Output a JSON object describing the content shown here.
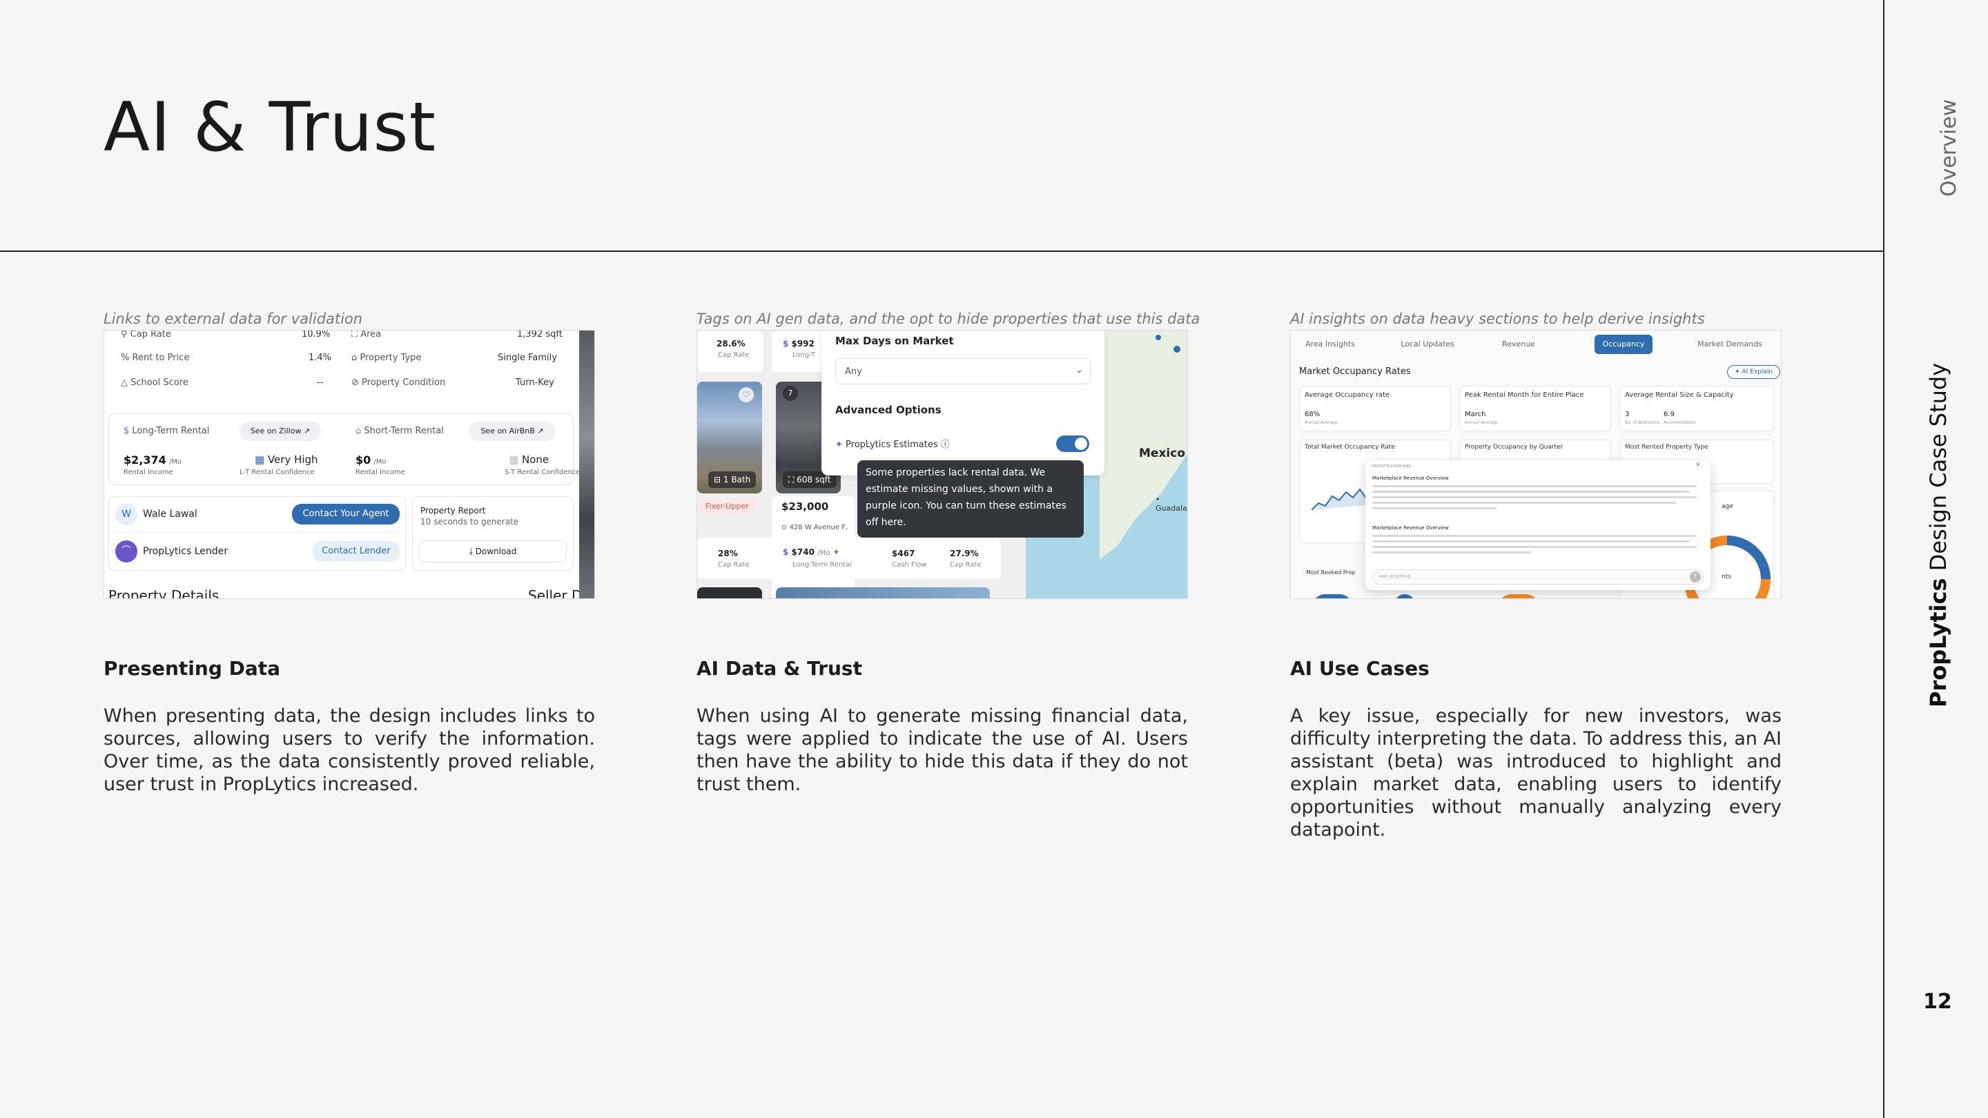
{
  "page": {
    "title": "AI & Trust",
    "side_overview": "Overview",
    "side_brand": "PropLytics",
    "side_study": "Design Case Study",
    "page_number": "12"
  },
  "columns": [
    {
      "caption": "Links to external data for validation",
      "heading": "Presenting Data",
      "body": "When presenting data, the design includes links to sources, allowing users to verify the information. Over time, as the data consistently proved reliable, user trust in PropLytics increased."
    },
    {
      "caption": "Tags on AI gen data, and the opt to hide properties that use this data",
      "heading": "AI Data & Trust",
      "body": "When using AI to generate missing financial data, tags were applied to indicate the use of AI. Users then have the ability to hide this data if they do not trust them."
    },
    {
      "caption": "AI insights on data heavy sections to help derive insights",
      "heading": "AI Use Cases",
      "body": "A key issue, especially for new investors, was difficulty interpreting the data. To address this, an AI assistant (beta) was introduced to highlight and explain market data, enabling users to identify opportunities without manually analyzing every datapoint."
    }
  ],
  "shot1": {
    "rows": [
      {
        "label": "Cap Rate",
        "value": "10.9%",
        "label2": "Area",
        "value2": "1,392 sqft"
      },
      {
        "label": "Rent to Price",
        "value": "1.4%",
        "label2": "Property Type",
        "value2": "Single Family"
      },
      {
        "label": "School Score",
        "value": "--",
        "label2": "Property Condition",
        "value2": "Turn-Key"
      }
    ],
    "long_term": {
      "label": "Long-Term Rental",
      "link": "See on Zillow",
      "amount": "$2,374",
      "unit": "/Mo",
      "sub": "Rental Income",
      "confidence": "Very High",
      "confidence_sub": "L-T Rental Confidence"
    },
    "short_term": {
      "label": "Short-Term Rental",
      "link": "See on AirBnB",
      "amount": "$0",
      "unit": "/Mo",
      "sub": "Rental Income",
      "confidence": "None",
      "confidence_sub": "S-T Rental Confidence"
    },
    "agent": {
      "initial": "W",
      "name": "Wale Lawal",
      "button": "Contact Your Agent"
    },
    "lender": {
      "name": "PropLytics Lender",
      "button": "Contact Lender"
    },
    "report": {
      "title": "Property Report",
      "sub": "10 seconds to generate",
      "button": "Download"
    },
    "footer_left": "Property Details",
    "footer_right": "Seller De"
  },
  "shot2": {
    "card_a": {
      "cap": "28.6%",
      "cap_label": "Cap Rate",
      "price": "$992",
      "price_label": "Long-T"
    },
    "bath": "1 Bath",
    "sqft": "608 sqft",
    "badge_number": "7",
    "fixer": "Fixer-Upper",
    "price": "$23,000",
    "address": "428 W Avenue F,",
    "card_b": {
      "cap": "28%",
      "cap_label": "Cap Rate",
      "rent": "$740",
      "rent_unit": "/Mo",
      "rent_label": "Long-Term Rental",
      "cash": "$467",
      "cash_label": "Cash Flow",
      "cap2": "27.9%",
      "cap2_label": "Cap Rate"
    },
    "panel_title": "Max Days on Market",
    "select_value": "Any",
    "advanced": "Advanced Options",
    "estimates": "PropLytics Estimates",
    "tooltip": "Some properties lack rental data. We estimate missing values, shown with a purple icon. You can turn these estimates off here.",
    "map_label": "Mexico",
    "map_label2": "Guadala"
  },
  "shot3": {
    "tabs": [
      "Area Insights",
      "Local Updates",
      "Revenue",
      "Occupancy",
      "Market Demands"
    ],
    "section_title": "Market Occupancy Rates",
    "ai_button": "AI Explain",
    "cards": [
      {
        "title": "Average Occupancy rate",
        "value": "68%",
        "sub": "Annual Average"
      },
      {
        "title": "Peak Rental Month for Entire Place",
        "value": "March",
        "sub": "Annual Average"
      },
      {
        "title": "Average Rental Size & Capacity",
        "value": "3",
        "value2": "6.9",
        "sub": "No. of Bedrooms",
        "sub2": "Accommodates"
      }
    ],
    "row2": [
      "Total Market Occupancy Rate",
      "Property Occupancy by Quarter",
      "Most Rented Property Type"
    ],
    "modal_label": "PROPLYTICS EXPLAINS",
    "modal_heading1": "Marketplace Revenue Overview",
    "modal_heading2": "Marketplace Revenue Overview",
    "modal_input": "Ask anything",
    "bottom_left": "Most Booked Prop",
    "side_a": "age",
    "side_b": "nts"
  }
}
